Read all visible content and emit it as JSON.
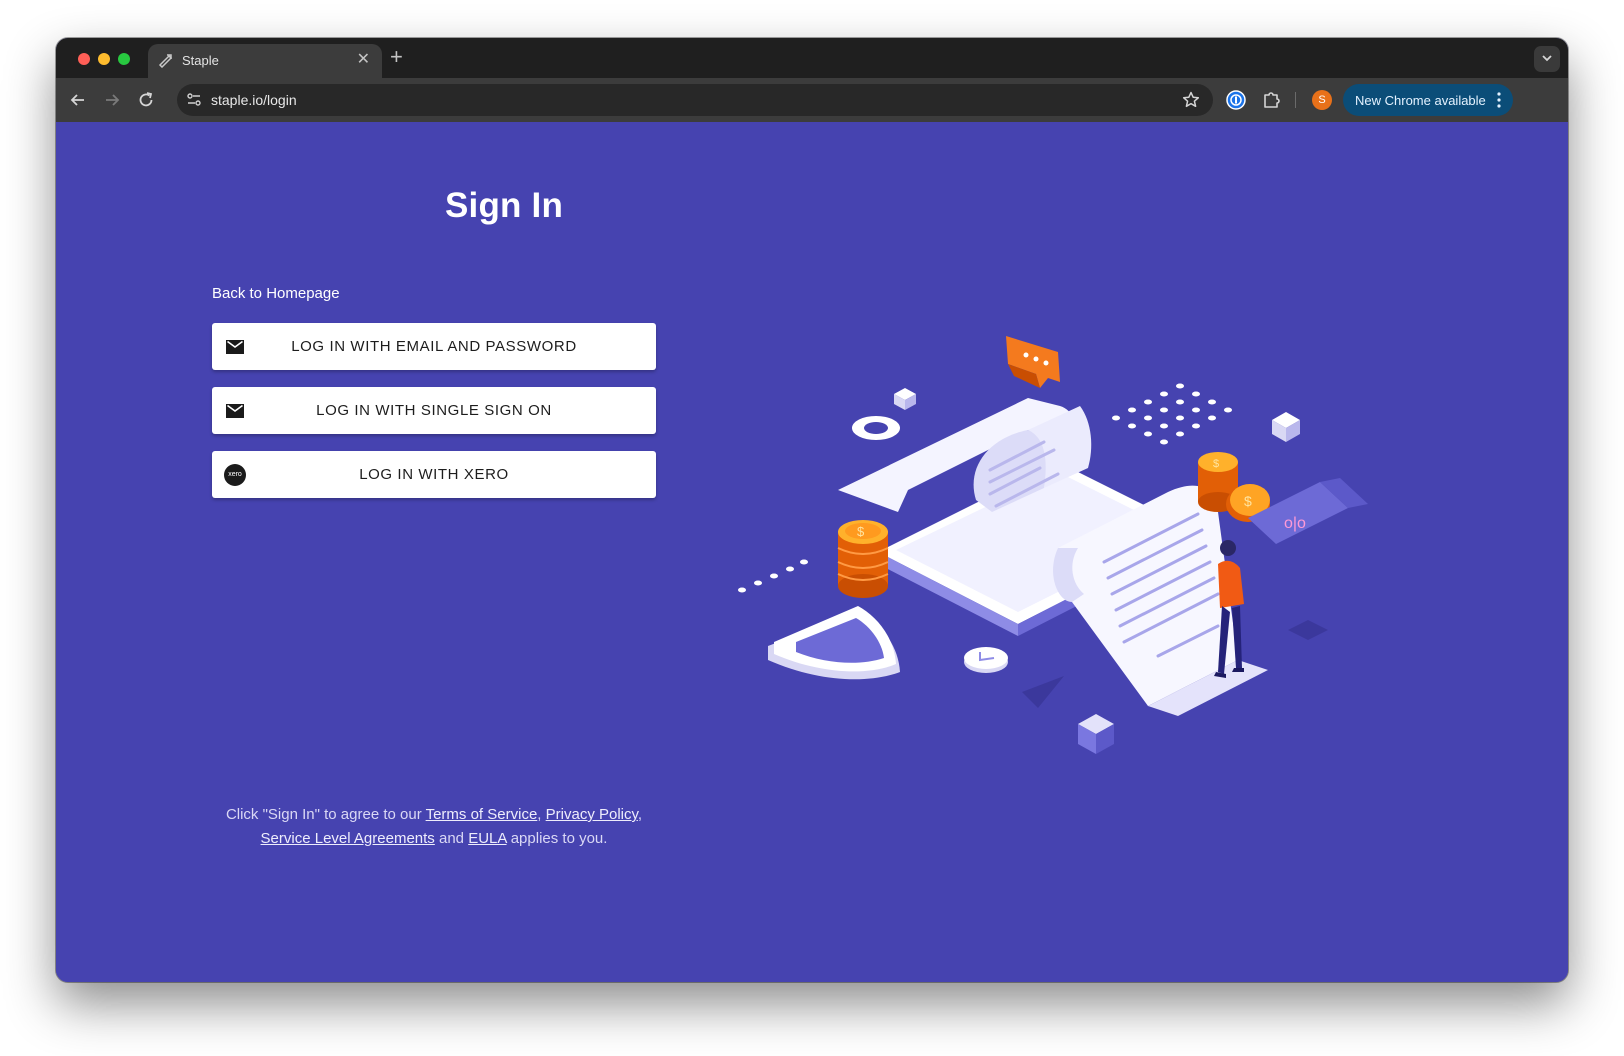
{
  "browser": {
    "tab": {
      "title": "Staple",
      "close_glyph": "✕"
    },
    "new_tab_glyph": "+",
    "address": {
      "url": "staple.io/login"
    },
    "profile_initial": "S",
    "update_button": {
      "label": "New Chrome available"
    }
  },
  "page": {
    "title": "Sign In",
    "back_link": "Back to Homepage",
    "buttons": [
      {
        "label": "LOG IN WITH EMAIL AND PASSWORD",
        "icon": "mail-icon"
      },
      {
        "label": "LOG IN WITH SINGLE SIGN ON",
        "icon": "mail-icon"
      },
      {
        "label": "LOG IN WITH XERO",
        "icon": "xero-logo-icon",
        "badge_text": "xero"
      }
    ],
    "legal": {
      "prefix": "Click \"Sign In\" to agree to our ",
      "terms": "Terms of Service",
      "comma1": ", ",
      "privacy": "Privacy Policy",
      "comma2": ",",
      "sla": "Service Level Agreements",
      "and": " and ",
      "eula": "EULA",
      "suffix": " applies to you."
    }
  },
  "colors": {
    "page_background": "#4643b0",
    "accent_orange": "#f47a1e",
    "button_background": "#ffffff",
    "update_button": "#0b4d78"
  }
}
